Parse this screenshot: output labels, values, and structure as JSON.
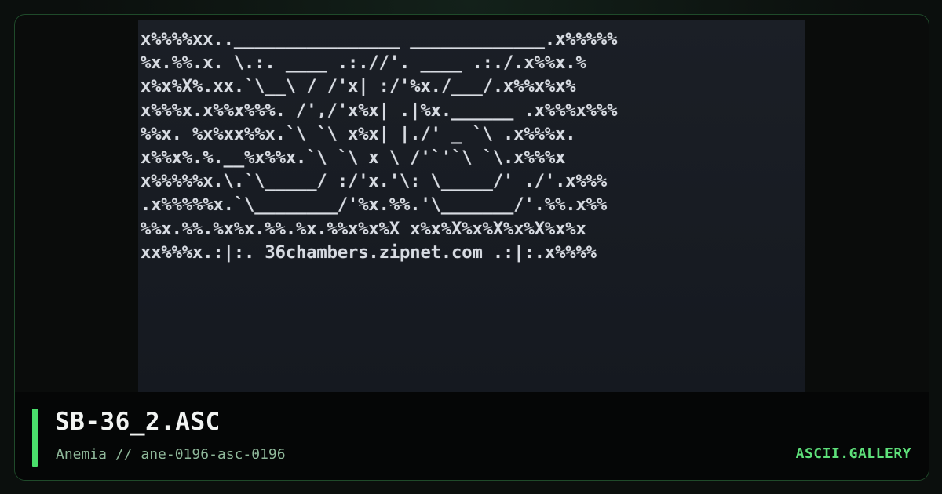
{
  "artwork": {
    "lines": [
      "x%%%%xx..________________ _____________.x%%%%%",
      "%x.%%.x. \\.:. ____ .:.//'. ____ .:./.x%%x.%",
      "x%x%X%.xx.`\\__\\ / /'x| :/'%x./___/.x%%x%x%",
      "x%%%x.x%%x%%%. /',/'x%x| .|%x.______ .x%%%x%%%",
      "%%x. %x%xx%%x.`\\ `\\ x%x| |./' _ `\\ .x%%%x.",
      "x%%x%.%.__%x%%x.`\\ `\\ x \\ /'`'`\\ `\\.x%%%x",
      "x%%%%%x.\\.`\\_____/ :/'x.'\\: \\_____/' ./'.x%%%",
      ".x%%%%%x.`\\________/'%x.%%.'\\_______/'.%%.x%%",
      "%%x.%%.%x%x.%%.%x.%%x%x%X x%x%X%x%X%x%X%x%x",
      "xx%%%x.:|:. 36chambers.zipnet.com .:|:.x%%%%"
    ]
  },
  "footer": {
    "title": "SB-36_2.ASC",
    "subtitle": "Anemia // ane-0196-asc-0196",
    "brand": "ASCII.GALLERY"
  },
  "colors": {
    "accent": "#4ade6b",
    "background": "#0b0f0d",
    "art_background": "#171b21",
    "art_text": "#d7dbe2"
  }
}
